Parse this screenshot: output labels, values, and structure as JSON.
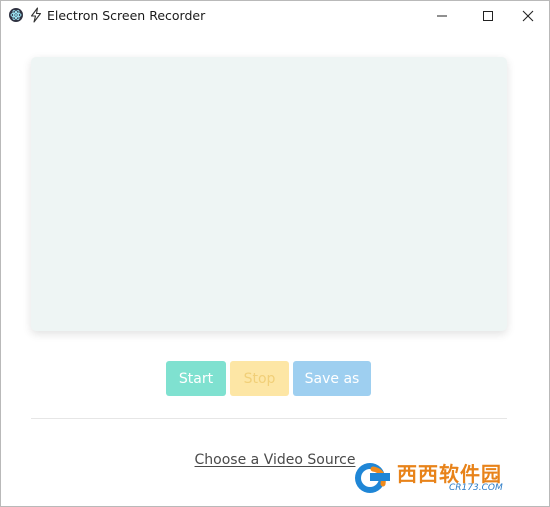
{
  "window": {
    "title": "Electron Screen Recorder"
  },
  "controls": {
    "start_label": "Start",
    "stop_label": "Stop",
    "save_label": "Save as"
  },
  "source": {
    "link_label": "Choose a Video Source"
  },
  "watermark": {
    "brand": "西西软件园",
    "url": "CR173.COM"
  },
  "colors": {
    "start": "#7fe1d0",
    "stop": "#fde6a5",
    "save": "#9ecff0",
    "preview_bg": "#eef5f4"
  }
}
